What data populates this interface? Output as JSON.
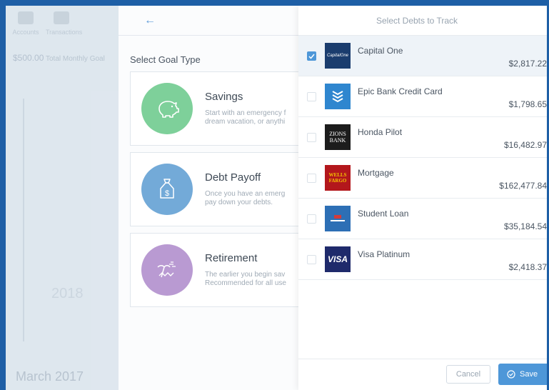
{
  "app_bg": {
    "nav": [
      "Accounts",
      "Transactions"
    ],
    "amount_value": "$500.00",
    "amount_label": "Total Monthly Goal",
    "year": "2018",
    "date": "March 2017"
  },
  "goal_panel": {
    "back_icon": "arrow-left-icon",
    "title": "Select Goal Type",
    "goals": [
      {
        "name": "Savings",
        "icon": "piggy-bank-icon",
        "color": "#7ed09a",
        "desc_line1": "Start with an emergency f",
        "desc_line2": "dream vacation, or anythi"
      },
      {
        "name": "Debt Payoff",
        "icon": "money-bag-icon",
        "color": "#73aad8",
        "desc_line1": "Once you have an emerg",
        "desc_line2": "pay down your debts."
      },
      {
        "name": "Retirement",
        "icon": "palm-beach-icon",
        "color": "#b99ad2",
        "desc_line1": "The earlier you begin sav",
        "desc_line2": "Recommended for all use"
      }
    ]
  },
  "debts_panel": {
    "title": "Select Debts to Track",
    "debts": [
      {
        "name": "Capital One",
        "amount": "$2,817.22",
        "checked": true,
        "logo_text": "CapitalOne",
        "logo_bg": "#1b3d6e"
      },
      {
        "name": "Epic Bank Credit Card",
        "amount": "$1,798.65",
        "checked": false,
        "logo_text": "",
        "logo_bg": "#2f86cf"
      },
      {
        "name": "Honda Pilot",
        "amount": "$16,482.97",
        "checked": false,
        "logo_text": "ZIONS BANK",
        "logo_bg": "#1c1c1c"
      },
      {
        "name": "Mortgage",
        "amount": "$162,477.84",
        "checked": false,
        "logo_text": "WELLS FARGO",
        "logo_bg": "#b3171c"
      },
      {
        "name": "Student Loan",
        "amount": "$35,184.54",
        "checked": false,
        "logo_text": "",
        "logo_bg": "#2d6fb5"
      },
      {
        "name": "Visa Platinum",
        "amount": "$2,418.37",
        "checked": false,
        "logo_text": "VISA",
        "logo_bg": "#1f2a6b"
      }
    ],
    "cancel_label": "Cancel",
    "save_label": "Save"
  }
}
